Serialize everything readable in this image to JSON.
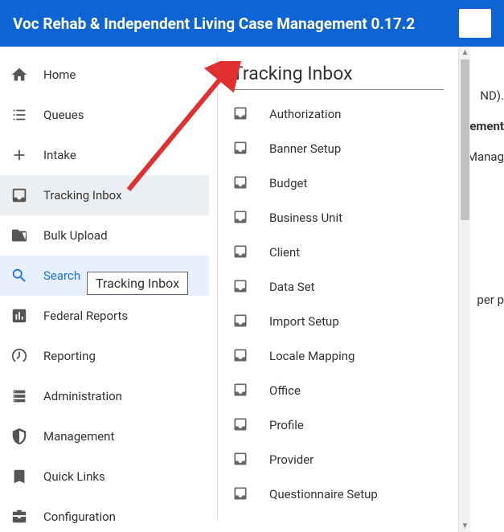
{
  "header": {
    "title": "Voc Rehab & Independent Living Case Management 0.17.2"
  },
  "sidebar": {
    "items": [
      {
        "label": "Home",
        "icon": "home"
      },
      {
        "label": "Queues",
        "icon": "list"
      },
      {
        "label": "Intake",
        "icon": "plus"
      },
      {
        "label": "Tracking Inbox",
        "icon": "inbox",
        "selected": true
      },
      {
        "label": "Bulk Upload",
        "icon": "folder"
      },
      {
        "label": "Search",
        "icon": "search",
        "highlight": "search"
      },
      {
        "label": "Federal Reports",
        "icon": "barchart"
      },
      {
        "label": "Reporting",
        "icon": "gauge"
      },
      {
        "label": "Administration",
        "icon": "servers"
      },
      {
        "label": "Management",
        "icon": "shield"
      },
      {
        "label": "Quick Links",
        "icon": "bookmark"
      },
      {
        "label": "Configuration",
        "icon": "toolbox"
      }
    ]
  },
  "tooltip": {
    "text": "Tracking Inbox"
  },
  "flyout": {
    "title": "Tracking Inbox",
    "items": [
      {
        "label": "Authorization"
      },
      {
        "label": "Banner Setup"
      },
      {
        "label": "Budget"
      },
      {
        "label": "Business Unit"
      },
      {
        "label": "Client"
      },
      {
        "label": "Data Set"
      },
      {
        "label": "Import Setup"
      },
      {
        "label": "Locale Mapping"
      },
      {
        "label": "Office"
      },
      {
        "label": "Profile"
      },
      {
        "label": "Provider"
      },
      {
        "label": "Questionnaire Setup"
      }
    ]
  },
  "background": {
    "frag1": "ND).",
    "frag2": "ement",
    "frag3": "Manag",
    "frag4": "per p"
  }
}
